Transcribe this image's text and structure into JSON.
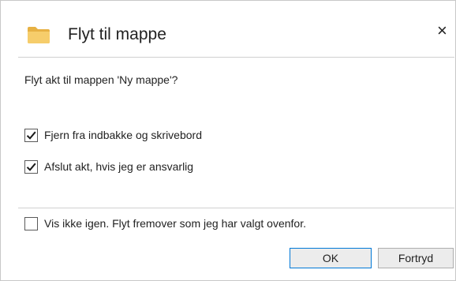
{
  "dialog": {
    "title": "Flyt til mappe",
    "close_glyph": "×",
    "icon": "folder-icon",
    "question": "Flyt akt til mappen 'Ny mappe'?"
  },
  "options": [
    {
      "label": "Fjern fra indbakke og skrivebord",
      "checked": true
    },
    {
      "label": "Afslut akt, hvis jeg er ansvarlig",
      "checked": true
    }
  ],
  "dont_show_again": {
    "label": "Vis ikke igen. Flyt fremover som jeg har valgt ovenfor.",
    "checked": false
  },
  "buttons": {
    "ok_label": "OK",
    "cancel_label": "Fortryd"
  },
  "colors": {
    "folder": "#f2c45a",
    "default_button_border": "#0078d7",
    "divider": "#d0d0d0"
  }
}
